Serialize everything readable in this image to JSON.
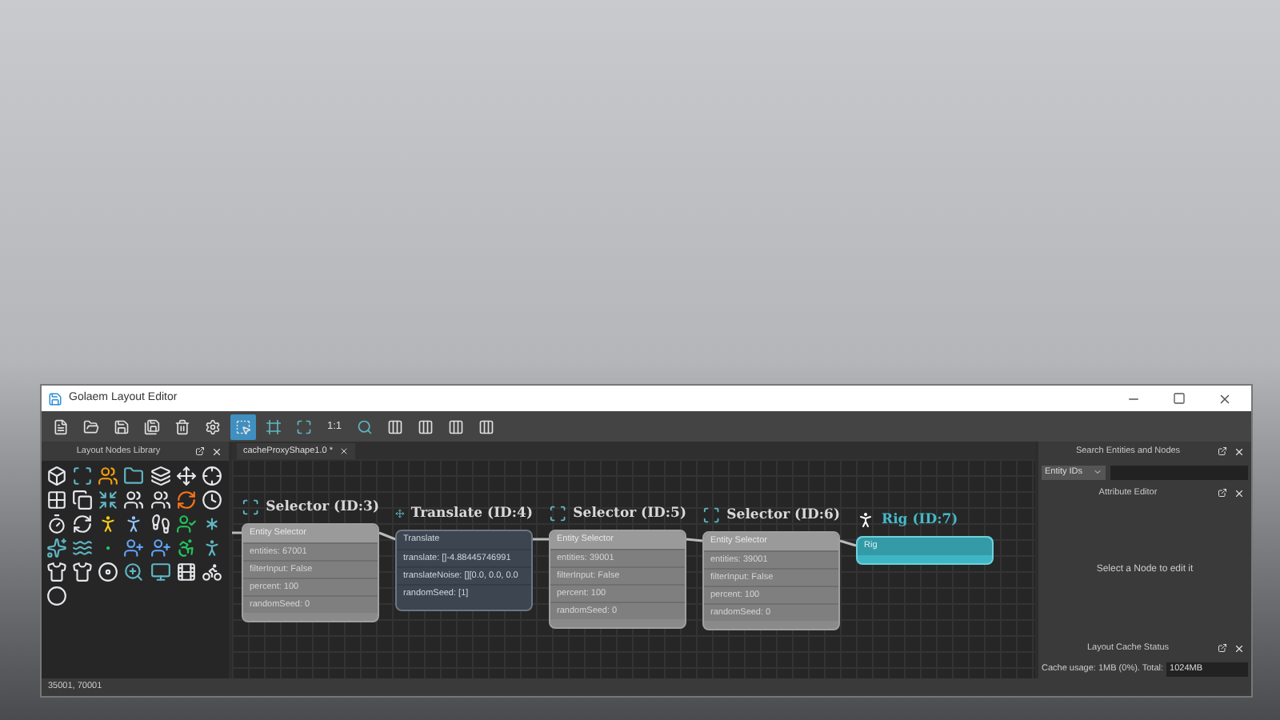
{
  "window": {
    "title": "Golaem Layout Editor"
  },
  "toolbar": [
    {
      "kind": "new",
      "selected": false
    },
    {
      "kind": "open",
      "selected": false
    },
    {
      "kind": "save",
      "selected": false
    },
    {
      "kind": "save-as",
      "selected": false
    },
    {
      "kind": "delete",
      "selected": false
    },
    {
      "kind": "settings",
      "selected": false
    },
    {
      "kind": "select",
      "selected": true
    },
    {
      "kind": "frame",
      "selected": false
    },
    {
      "kind": "frame-all",
      "selected": false
    },
    {
      "kind": "text",
      "label": "1:1",
      "selected": false
    },
    {
      "kind": "zoom",
      "selected": false
    },
    {
      "kind": "layout",
      "selected": false
    },
    {
      "kind": "layout",
      "selected": false
    },
    {
      "kind": "layout",
      "selected": false
    },
    {
      "kind": "layout",
      "selected": false
    }
  ],
  "library": {
    "title": "Layout Nodes Library"
  },
  "graph": {
    "tab": "cacheProxyShape1.0 *",
    "nodes": [
      {
        "kind": "selector",
        "title": "Selector (ID:3)",
        "header": "Entity Selector",
        "rows": [
          "entities: 67001",
          "filterInput: False",
          "percent: 100",
          "randomSeed: 0"
        ]
      },
      {
        "kind": "translate",
        "title": "Translate (ID:4)",
        "header": "Translate",
        "rows": [
          "translate: []-4.88445746991",
          "translateNoise: [][0.0, 0.0, 0.0",
          "randomSeed: [1]"
        ]
      },
      {
        "kind": "selector",
        "title": "Selector (ID:5)",
        "header": "Entity Selector",
        "rows": [
          "entities: 39001",
          "filterInput: False",
          "percent: 100",
          "randomSeed: 0"
        ]
      },
      {
        "kind": "selector",
        "title": "Selector (ID:6)",
        "header": "Entity Selector",
        "rows": [
          "entities: 39001",
          "filterInput: False",
          "percent: 100",
          "randomSeed: 0"
        ]
      },
      {
        "kind": "rig",
        "title": "Rig (ID:7)",
        "header": "Rig"
      }
    ]
  },
  "search_panel": {
    "title": "Search Entities and Nodes",
    "dropdown": "Entity IDs"
  },
  "attribute_editor": {
    "title": "Attribute Editor",
    "message": "Select a Node to edit it"
  },
  "cache_panel": {
    "title": "Layout Cache Status",
    "usage": "Cache usage: 1MB (0%). Total:",
    "total": "1024MB"
  },
  "status_bar": "35001, 70001"
}
